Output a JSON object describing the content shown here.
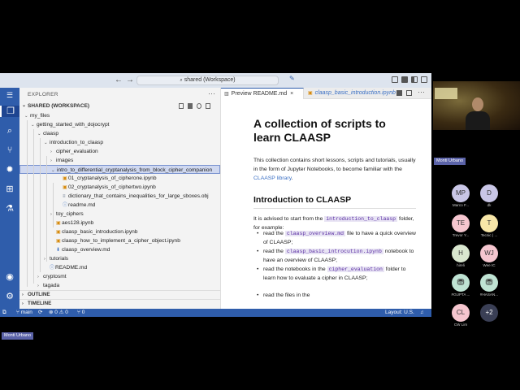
{
  "window": {
    "search_label": "shared (Workspace)",
    "nav_back": "←",
    "nav_forward": "→"
  },
  "sidebar": {
    "title": "EXPLORER",
    "more": "···",
    "workspace_label": "SHARED (WORKSPACE)",
    "tree": [
      {
        "label": "my_files",
        "chevron": "⌄",
        "icon": "",
        "indent": 0
      },
      {
        "label": "getting_started_with_dojocrypt",
        "chevron": "⌄",
        "icon": "",
        "indent": 1
      },
      {
        "label": "claasp",
        "chevron": "⌄",
        "icon": "",
        "indent": 2
      },
      {
        "label": "introduction_to_claasp",
        "chevron": "⌄",
        "icon": "",
        "indent": 3
      },
      {
        "label": "cipher_evaluation",
        "chevron": "›",
        "icon": "",
        "indent": 4
      },
      {
        "label": "images",
        "chevron": "›",
        "icon": "",
        "indent": 4
      },
      {
        "label": "intro_to_differential_cryptanalysis_from_block_cipher_companion",
        "chevron": "⌄",
        "icon": "",
        "indent": 4
      },
      {
        "label": "01_cryptanalysis_of_cipherone.ipynb",
        "chevron": "",
        "icon": "▣",
        "indent": 5
      },
      {
        "label": "02_cryptanalysis_of_ciphertwo.ipynb",
        "chevron": "",
        "icon": "▣",
        "indent": 5
      },
      {
        "label": "dictionary_that_contains_inequalities_for_large_sboxes.obj",
        "chevron": "",
        "icon": "≡",
        "indent": 5
      },
      {
        "label": "readme.md",
        "chevron": "",
        "icon": "ⓘ",
        "indent": 5
      },
      {
        "label": "toy_ciphers",
        "chevron": "›",
        "icon": "",
        "indent": 4
      },
      {
        "label": "aes128.ipynb",
        "chevron": "",
        "icon": "▣",
        "indent": 4
      },
      {
        "label": "claasp_basic_introduction.ipynb",
        "chevron": "",
        "icon": "▣",
        "indent": 4
      },
      {
        "label": "claasp_how_to_implement_a_cipher_object.ipynb",
        "chevron": "",
        "icon": "▣",
        "indent": 4
      },
      {
        "label": "claasp_overview.md",
        "chevron": "",
        "icon": "⬇",
        "indent": 4
      },
      {
        "label": "tutorials",
        "chevron": "›",
        "icon": "",
        "indent": 3
      },
      {
        "label": "README.md",
        "chevron": "",
        "icon": "ⓘ",
        "indent": 3
      },
      {
        "label": "cryptosmt",
        "chevron": "›",
        "icon": "",
        "indent": 2
      },
      {
        "label": "tagada",
        "chevron": "›",
        "icon": "",
        "indent": 2
      }
    ],
    "outline_label": "OUTLINE",
    "timeline_label": "TIMELINE"
  },
  "editor": {
    "tabs": [
      {
        "label": "Preview README.md",
        "active": true
      },
      {
        "label": "claasp_basic_introduction.ipynb",
        "active": false
      }
    ],
    "tab_close": "×",
    "preview": {
      "h1": "A collection of scripts to learn CLAASP",
      "intro_1": "This collection contains short lessons, scripts and tutorials, usually in the form of Jupyter Notebooks, to become familiar with the ",
      "intro_link": "CLAASP library",
      "intro_2": ".",
      "h2": "Introduction to CLAASP",
      "advise_1": "It is advised to start from the ",
      "advise_code": "introduction_to_claasp",
      "advise_2": " folder, for example:",
      "bullets": [
        {
          "pre": "read the ",
          "code": "claasp_overview.md",
          "post": " file to have a quick overview of CLAASP;"
        },
        {
          "pre": "read the ",
          "code": "claasp_basic_introcution.ipynb",
          "post": " notebook to have an overview of CLAASP;"
        },
        {
          "pre": "read the notebooks in the ",
          "code": "cipher_evaluation",
          "post": " folder to learn how to evaluate a cipher in CLAASP;"
        },
        {
          "pre": "read the files in the",
          "code": "",
          "post": ""
        }
      ]
    }
  },
  "statusbar": {
    "branch": "main",
    "sync": "⟳",
    "errors": "⊗ 0 ⚠ 0",
    "ports": "⑂ 0",
    "layout": "Layout: U.S.",
    "bell": "🔔"
  },
  "participants": {
    "presenter_name": "Monti Urbano",
    "self_name": "Monti Urbano",
    "avatars": [
      {
        "initials": "MP",
        "label": "Marco F...",
        "bg": "#c9c6e6"
      },
      {
        "initials": "D",
        "label": "dk",
        "bg": "#c9c6e6"
      },
      {
        "initials": "TE",
        "label": "Trevor Y...",
        "bg": "#f5c6cf"
      },
      {
        "initials": "T",
        "label": "Tecnic | ...",
        "bg": "#f7e6a8"
      },
      {
        "initials": "H",
        "label": "hireli",
        "bg": "#d9e7cf"
      },
      {
        "initials": "WJ",
        "label": "Wee IC",
        "bg": "#f5c6cf"
      },
      {
        "initials": "",
        "label": "#GUPTA ...",
        "bg": "#bfe3d3"
      },
      {
        "initials": "",
        "label": "#HASAN...",
        "bg": "#bfe3d3"
      },
      {
        "initials": "CL",
        "label": "CW Lim",
        "bg": "#f5c6cf"
      },
      {
        "initials": "+2",
        "label": "",
        "bg": "#3a3f55"
      }
    ]
  },
  "colors": {
    "accent": "#2f5dab",
    "code_text": "#5b2fa3",
    "link": "#3a6fc4"
  }
}
